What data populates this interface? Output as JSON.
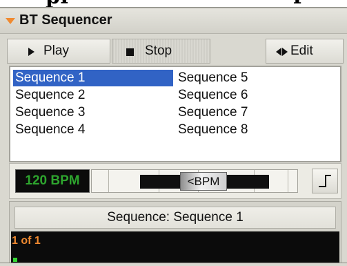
{
  "header_fragment": {
    "left": "pl",
    "right": "r"
  },
  "panel": {
    "title": "BT Sequencer"
  },
  "transport": {
    "play_label": "Play",
    "stop_label": "Stop",
    "edit_label": "Edit"
  },
  "sequences": [
    {
      "label": "Sequence 1",
      "selected": true
    },
    {
      "label": "Sequence 2",
      "selected": false
    },
    {
      "label": "Sequence 3",
      "selected": false
    },
    {
      "label": "Sequence 4",
      "selected": false
    },
    {
      "label": "Sequence 5",
      "selected": false
    },
    {
      "label": "Sequence 6",
      "selected": false
    },
    {
      "label": "Sequence 7",
      "selected": false
    },
    {
      "label": "Sequence 8",
      "selected": false
    }
  ],
  "tempo": {
    "display": "120 BPM",
    "slider_label": "BPM",
    "slider_arrow": "<"
  },
  "status": {
    "current": "Sequence: Sequence 1",
    "progress_text": "1 of 1"
  },
  "colors": {
    "accent_orange": "#f08a30",
    "selection_blue": "#3163c5",
    "lcd_green": "#2ea52e"
  },
  "icons": {
    "title": "collapse-triangle-icon",
    "play": "play-icon",
    "stop": "stop-icon",
    "edit": "edit-arrows-icon",
    "step": "step-waveform-icon"
  }
}
